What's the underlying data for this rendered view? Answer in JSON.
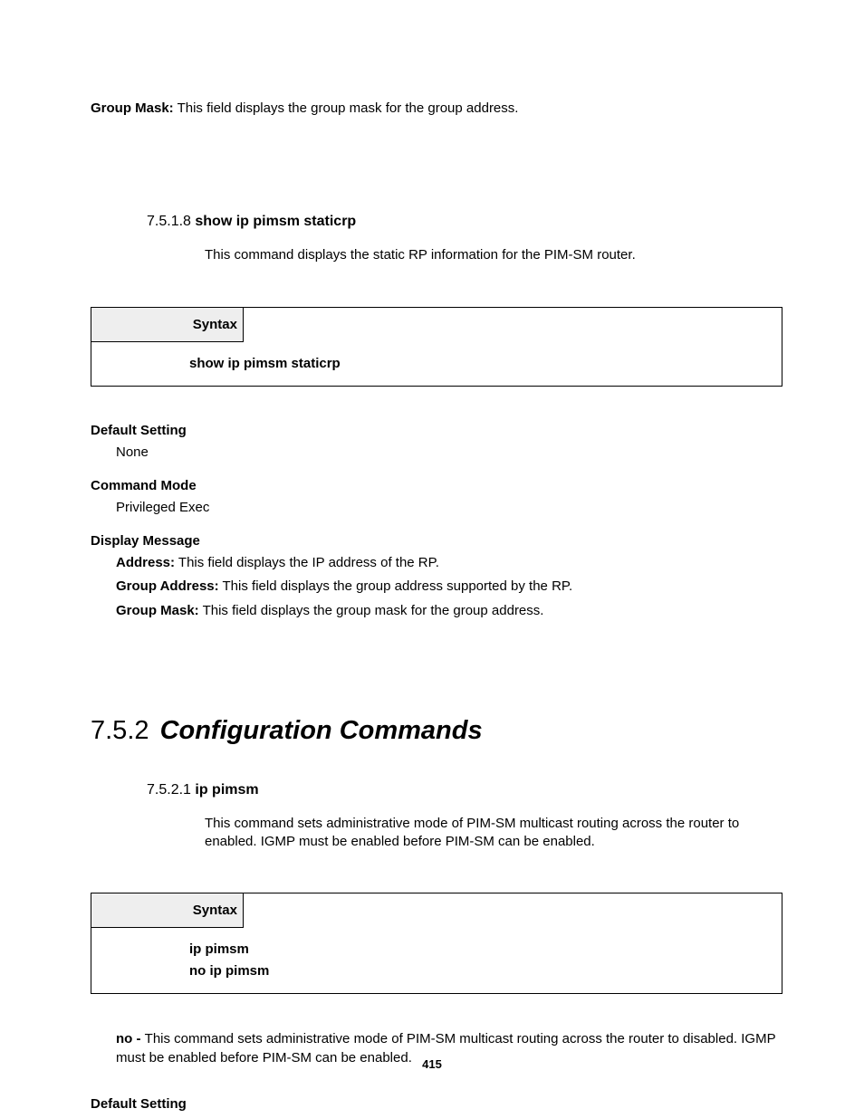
{
  "top_line": {
    "label": "Group Mask:",
    "text": " This field displays the group mask for the group address."
  },
  "sec_7_5_1_8": {
    "num": "7.5.1.8 ",
    "title": "show ip pimsm staticrp",
    "desc": "This command displays the static RP information for the PIM-SM router.",
    "syntax_label": "Syntax",
    "syntax_body": "show ip pimsm staticrp",
    "default_label": "Default Setting",
    "default_val": "None",
    "mode_label": "Command Mode",
    "mode_val": "Privileged Exec",
    "display_label": "Display Message",
    "msgs": [
      {
        "b": "Address:",
        "t": " This field displays the IP address of the RP."
      },
      {
        "b": "Group Address:",
        "t": " This field displays the group address supported by the RP."
      },
      {
        "b": "Group Mask:",
        "t": " This field displays the group mask for the group address."
      }
    ]
  },
  "sec_7_5_2": {
    "num": "7.5.2 ",
    "title": "Configuration Commands"
  },
  "sec_7_5_2_1": {
    "num": "7.5.2.1 ",
    "title": "ip pimsm",
    "desc": "This command sets administrative mode of PIM-SM multicast routing across the router to enabled. IGMP must be enabled before PIM-SM can be enabled.",
    "syntax_label": "Syntax",
    "syntax_line1": "ip pimsm",
    "syntax_line2": "no ip pimsm",
    "no_label": "no - ",
    "no_text": "This command sets administrative mode of PIM-SM multicast routing across the router to disabled. IGMP must be enabled before PIM-SM can be enabled.",
    "default_label": "Default Setting"
  },
  "page_number": "415"
}
